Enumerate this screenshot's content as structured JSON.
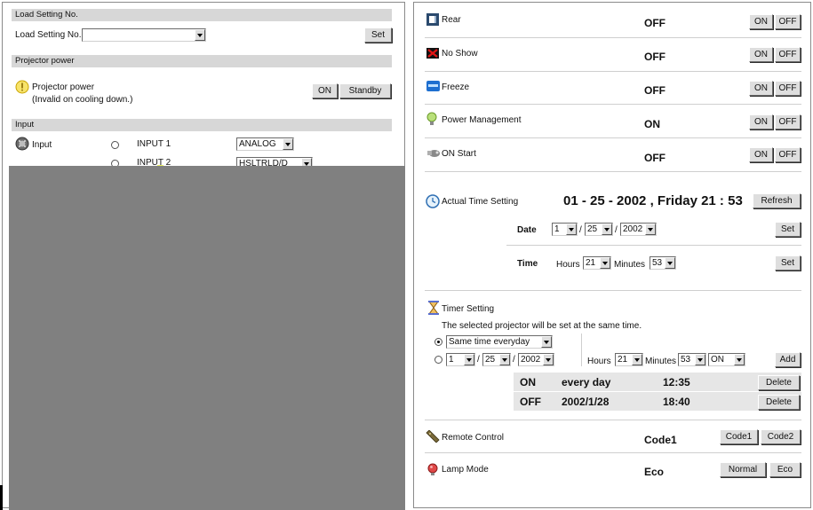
{
  "left_panel": {
    "load_setting": {
      "header": "Load Setting No.",
      "label": "Load Setting No.",
      "select_value": "",
      "set_label": "Set"
    },
    "projector_power": {
      "header": "Projector power",
      "label": "Projector power",
      "note": "(Invalid on cooling down.)",
      "on_label": "ON",
      "standby_label": "Standby"
    },
    "input": {
      "header": "Input",
      "label": "Input",
      "input1_label": "INPUT 1",
      "input1_mode": "ANALOG",
      "input2_label_partial": "INPUT 2",
      "input2_mode_partial": "HSLTRLD/D"
    }
  },
  "right_panel": {
    "toggles": [
      {
        "name": "Rear",
        "state": "OFF",
        "on": "ON",
        "off": "OFF"
      },
      {
        "name": "No Show",
        "state": "OFF",
        "on": "ON",
        "off": "OFF"
      },
      {
        "name": "Freeze",
        "state": "OFF",
        "on": "ON",
        "off": "OFF"
      },
      {
        "name": "Power Management",
        "state": "ON",
        "on": "ON",
        "off": "OFF"
      },
      {
        "name": "ON Start",
        "state": "OFF",
        "on": "ON",
        "off": "OFF"
      }
    ],
    "time": {
      "label": "Actual Time Setting",
      "display": "01 - 25 - 2002 , Friday 21 : 53",
      "refresh_label": "Refresh",
      "date_label": "Date",
      "month": "1",
      "day": "25",
      "year": "2002",
      "slash": "/",
      "time_label": "Time",
      "hours_label": "Hours",
      "hours": "21",
      "minutes_label": "Minutes",
      "minutes": "53",
      "set_label": "Set"
    },
    "timer": {
      "label": "Timer Setting",
      "note": "The selected projector will be set at the same time.",
      "repeat_option": "Same time everyday",
      "month": "1",
      "day": "25",
      "year": "2002",
      "slash": "/",
      "hours_label": "Hours",
      "hours": "21",
      "minutes_label": "Minutes",
      "minutes": "53",
      "action": "ON",
      "add_label": "Add",
      "entries": [
        {
          "action": "ON",
          "when": "every day",
          "time": "12:35",
          "delete": "Delete"
        },
        {
          "action": "OFF",
          "when": "2002/1/28",
          "time": "18:40",
          "delete": "Delete"
        }
      ]
    },
    "remote": {
      "label": "Remote Control",
      "state": "Code1",
      "code1": "Code1",
      "code2": "Code2"
    },
    "lamp": {
      "label": "Lamp Mode",
      "state": "Eco",
      "normal": "Normal",
      "eco": "Eco"
    }
  }
}
